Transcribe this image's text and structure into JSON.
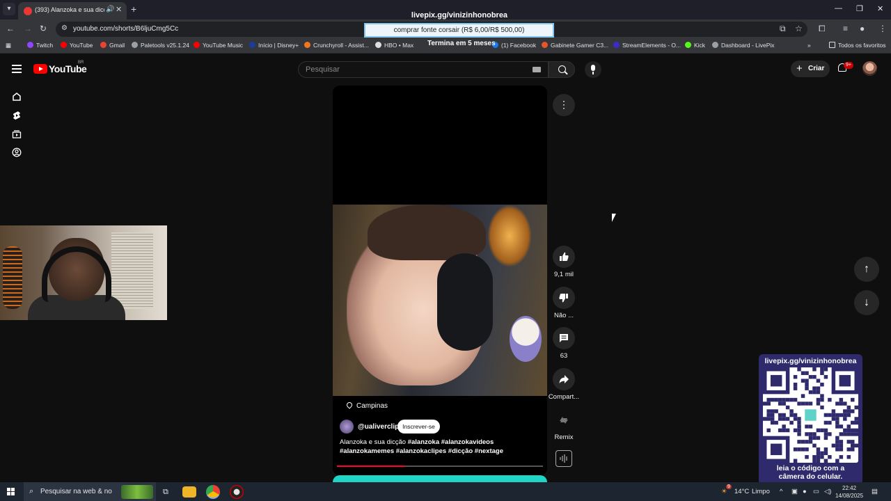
{
  "browser": {
    "tab_title": "(393) Alanzoka e sua dicção",
    "overlay_title": "livepix.gg/vinizinhonobrea",
    "url": "youtube.com/shorts/B6ljuCmg5Cc",
    "alert": "comprar fonte corsair (R$ 6,00/R$ 500,00)",
    "countdown": "Termina em 5 meses",
    "bookmarks": [
      "Twitch",
      "YouTube",
      "Gmail",
      "Paletools v25.1.24",
      "YouTube Music",
      "Início | Disney+",
      "Crunchyroll - Assist...",
      "HBO • Max",
      "(1) Facebook",
      "Gabinete Gamer C3...",
      "StreamElements - O...",
      "Kick",
      "Dashboard - LivePix"
    ],
    "all_bookmarks": "Todos os favoritos"
  },
  "youtube": {
    "logo_text": "YouTube",
    "region": "BR",
    "search_placeholder": "Pesquisar",
    "create_label": "Criar",
    "notif_badge": "9+"
  },
  "short": {
    "location": "Campinas",
    "channel": "@ualiverclip",
    "subscribe": "Inscrever-se",
    "description_plain": "Alanzoka e sua dicção ",
    "description_tags_line1": "#alanzoka #alanzokavideos",
    "description_tags_line2": "#alanzokamemes #alanzokaclipes #dicção #nextage",
    "progress": 0.33
  },
  "actions": {
    "likes": "9,1 mil",
    "dislike": "Não ...",
    "comments": "63",
    "share": "Compart...",
    "remix": "Remix"
  },
  "qr": {
    "header": "livepix.gg/vinizinhonobrea",
    "footer_line1": "leia o código com a",
    "footer_line2": "câmera do celular."
  },
  "taskbar": {
    "search": "Pesquisar na web & no",
    "temp": "14°C",
    "weather": "Limpo",
    "weather_badge": "9",
    "time": "22:42",
    "date": "14/08/2025"
  },
  "colors": {
    "bg": "#0f0f0f",
    "yt_red": "#ff0000",
    "progress_red": "#ff0033",
    "qr_card": "#2f2a6b"
  }
}
